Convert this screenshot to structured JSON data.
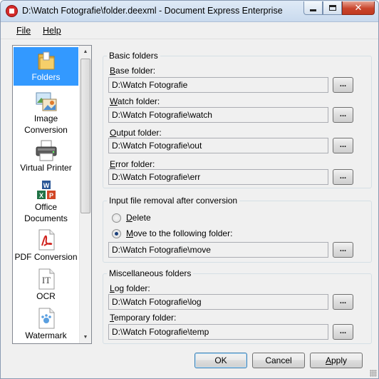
{
  "window": {
    "title": "D:\\Watch Fotografie\\folder.deexml - Document Express Enterprise",
    "close_label": "✕"
  },
  "menu": {
    "file": "File",
    "help": "Help"
  },
  "categories": [
    {
      "label": "Folders",
      "icon": "folder-icon",
      "selected": true
    },
    {
      "label": "Image\nConversion",
      "icon": "image-conversion-icon",
      "selected": false
    },
    {
      "label": "Virtual Printer",
      "icon": "printer-icon",
      "selected": false
    },
    {
      "label": "Office\nDocuments",
      "icon": "office-documents-icon",
      "selected": false
    },
    {
      "label": "PDF Conversion",
      "icon": "pdf-icon",
      "selected": false
    },
    {
      "label": "OCR",
      "icon": "ocr-icon",
      "selected": false
    },
    {
      "label": "Watermark",
      "icon": "watermark-icon",
      "selected": false
    }
  ],
  "basic": {
    "title": "Basic folders",
    "base_label_key": "B",
    "base_label_rest": "ase folder:",
    "base_value": "D:\\Watch Fotografie",
    "watch_label_key": "W",
    "watch_label_rest": "atch folder:",
    "watch_value": "D:\\Watch Fotografie\\watch",
    "output_label_key": "O",
    "output_label_rest": "utput folder:",
    "output_value": "D:\\Watch Fotografie\\out",
    "error_label_key": "E",
    "error_label_rest": "rror folder:",
    "error_value": "D:\\Watch Fotografie\\err"
  },
  "removal": {
    "title": "Input file removal after conversion",
    "delete_key": "D",
    "delete_rest": "elete",
    "delete_selected": false,
    "move_key": "M",
    "move_rest": "ove to the following folder:",
    "move_selected": true,
    "move_value": "D:\\Watch Fotografie\\move"
  },
  "misc": {
    "title": "Miscellaneous folders",
    "log_label_key": "L",
    "log_label_rest": "og folder:",
    "log_value": "D:\\Watch Fotografie\\log",
    "temp_label_key": "T",
    "temp_label_rest": "emporary folder:",
    "temp_value": "D:\\Watch Fotografie\\temp"
  },
  "browse_label": "...",
  "buttons": {
    "ok": "OK",
    "cancel": "Cancel",
    "apply_key": "A",
    "apply_rest": "pply"
  }
}
